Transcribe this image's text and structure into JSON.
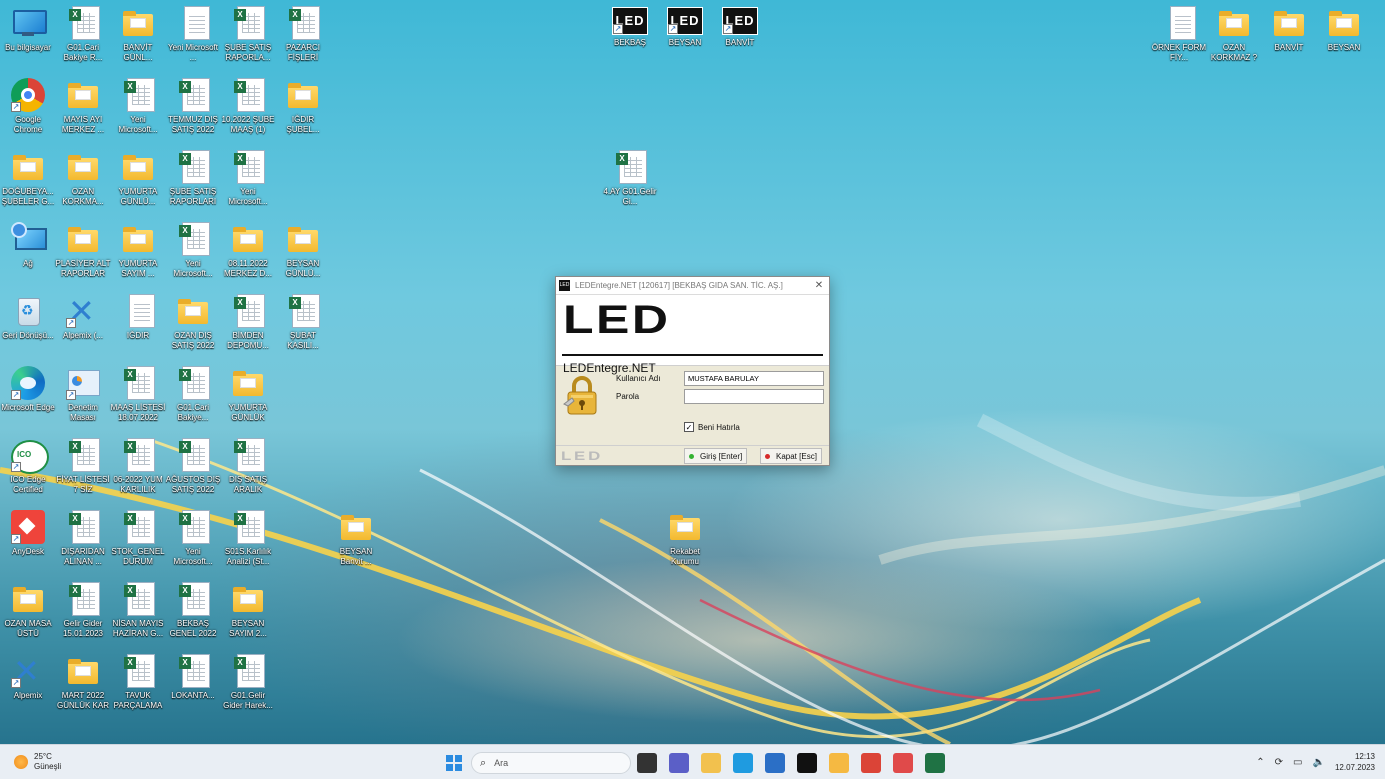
{
  "desktop": {
    "icons": [
      {
        "label": "Bu bilgisayar",
        "type": "monitor"
      },
      {
        "label": "G01.Cari Bakiye R...",
        "type": "xls"
      },
      {
        "label": "BANVİT GÜNL...",
        "type": "folder"
      },
      {
        "label": "Yeni Microsoft ...",
        "type": "doc"
      },
      {
        "label": "ŞUBE SATIŞ RAPORLA...",
        "type": "xls"
      },
      {
        "label": "PAZARCI FİŞLERİ",
        "type": "xls"
      },
      {
        "label": "Google Chrome",
        "type": "chrome"
      },
      {
        "label": "MAYIS AYI MERKEZ ...",
        "type": "folder"
      },
      {
        "label": "Yeni Microsoft...",
        "type": "xls"
      },
      {
        "label": "TEMMUZ DIŞ SATIŞ 2022",
        "type": "xls"
      },
      {
        "label": "10.2022 ŞUBE MAAŞ (1)",
        "type": "xls"
      },
      {
        "label": "IĞDIR ŞUBEL...",
        "type": "folder"
      },
      {
        "label": "DOĞUBEYA... ŞUBELER G...",
        "type": "folder"
      },
      {
        "label": "OZAN KORKMA...",
        "type": "folder"
      },
      {
        "label": "YUMURTA GÜNLÜ...",
        "type": "folder"
      },
      {
        "label": "ŞUBE SATIŞ RAPORLARI",
        "type": "xls"
      },
      {
        "label": "Yeni Microsoft...",
        "type": "xls"
      },
      {
        "label": "Ağ",
        "type": "network"
      },
      {
        "label": "PLASİYER ALT RAPORLAR",
        "type": "folder"
      },
      {
        "label": "YUMURTA SAYIM ...",
        "type": "folder"
      },
      {
        "label": "Yeni Microsoft...",
        "type": "xls"
      },
      {
        "label": "08.11.2022 MERKEZ D...",
        "type": "folder"
      },
      {
        "label": "BEYSAN GÜNLÜ...",
        "type": "folder"
      },
      {
        "label": "Geri Dönüşü...",
        "type": "recycle"
      },
      {
        "label": "Alpemix (...",
        "type": "alpemix"
      },
      {
        "label": "IĞDIR",
        "type": "doc"
      },
      {
        "label": "OZAN DIŞ SATIŞ 2022",
        "type": "folder"
      },
      {
        "label": "BİMDEN DEPOMU...",
        "type": "xls"
      },
      {
        "label": "ŞUBAT KASILI...",
        "type": "xls"
      },
      {
        "label": "Microsoft Edge",
        "type": "edge"
      },
      {
        "label": "Denetim Masası",
        "type": "control"
      },
      {
        "label": "MAAŞ LİSTESİ 18.07.2022",
        "type": "xls"
      },
      {
        "label": "G01.Cari Bakiye...",
        "type": "xls"
      },
      {
        "label": "YUMURTA GÜNLÜK",
        "type": "folder"
      },
      {
        "label": "ICO Edge Certified",
        "type": "ico-edge"
      },
      {
        "label": "FİYAT LİSTESİ 7 SİZ",
        "type": "xls"
      },
      {
        "label": "06-2022 YUM KARLILIK",
        "type": "xls"
      },
      {
        "label": "AĞUSTOS DIŞ SATIŞ 2022",
        "type": "xls"
      },
      {
        "label": "DIŞ SATIŞ ARALIK",
        "type": "xls"
      },
      {
        "label": "AnyDesk",
        "type": "anydesk"
      },
      {
        "label": "DIŞARIDAN ALINAN ...",
        "type": "xls"
      },
      {
        "label": "STOK_GENEL DURUM",
        "type": "xls"
      },
      {
        "label": "Yeni Microsoft...",
        "type": "xls"
      },
      {
        "label": "S01S.Karlılık Analizi (St...",
        "type": "xls"
      },
      {
        "label": "OZAN MASA ÜSTÜ",
        "type": "folder"
      },
      {
        "label": "Gelir Gider 15.01.2023",
        "type": "xls"
      },
      {
        "label": "NİSAN MAYIS HAZİRAN G...",
        "type": "xls"
      },
      {
        "label": "BEKBAŞ GENEL 2022",
        "type": "xls"
      },
      {
        "label": "BEYSAN SAYIM 2...",
        "type": "folder"
      },
      {
        "label": "Alpemix",
        "type": "alpemix"
      },
      {
        "label": "MART 2022 GÜNLÜK KAR",
        "type": "folder"
      },
      {
        "label": "TAVUK PARÇALAMA",
        "type": "xls"
      },
      {
        "label": "LOKANTA...",
        "type": "xls"
      },
      {
        "label": "G01.Gelir Gider Harek...",
        "type": "xls"
      },
      {
        "label": "BEKBAŞ",
        "type": "led"
      },
      {
        "label": "BEYSAN",
        "type": "led"
      },
      {
        "label": "BANVİT",
        "type": "led"
      },
      {
        "label": "4.AY G01.Gelir Gi...",
        "type": "xls"
      },
      {
        "label": "BEYSAN Banvit ...",
        "type": "folder"
      },
      {
        "label": "Rekabet Kurumu",
        "type": "folder"
      },
      {
        "label": "ÖRNEK FORM FİY...",
        "type": "doc"
      },
      {
        "label": "OZAN KORKMAZ ?",
        "type": "folder"
      },
      {
        "label": "BANVİT",
        "type": "folder"
      },
      {
        "label": "BEYSAN",
        "type": "folder"
      }
    ]
  },
  "dialog": {
    "title": "LEDEntegre.NET [120617] [BEKBAŞ GIDA SAN. TİC. AŞ.]",
    "logo": "LED",
    "product": "LEDEntegre.NET",
    "username_label": "Kullanıcı Adı",
    "username_value": "MUSTAFA BARULAY",
    "password_label": "Parola",
    "password_value": "",
    "remember_label": "Beni Hatırla",
    "remember_checked": true,
    "footer_logo": "LED",
    "login_button": "Giriş [Enter]",
    "close_button": "Kapat [Esc]",
    "colors": {
      "login_dot": "#34b233",
      "close_dot": "#d62b2b"
    }
  },
  "taskbar": {
    "weather_temp": "25°C",
    "weather_desc": "Güneşli",
    "search_placeholder": "Ara",
    "pinned": [
      "task-view-icon",
      "chat-icon",
      "file-explorer-icon",
      "edge-icon",
      "mail-icon",
      "led-app-icon",
      "folder-app-icon",
      "chrome-icon",
      "snipping-tool-icon",
      "excel-icon"
    ],
    "time": "12:13",
    "date": "12.07.2023"
  }
}
